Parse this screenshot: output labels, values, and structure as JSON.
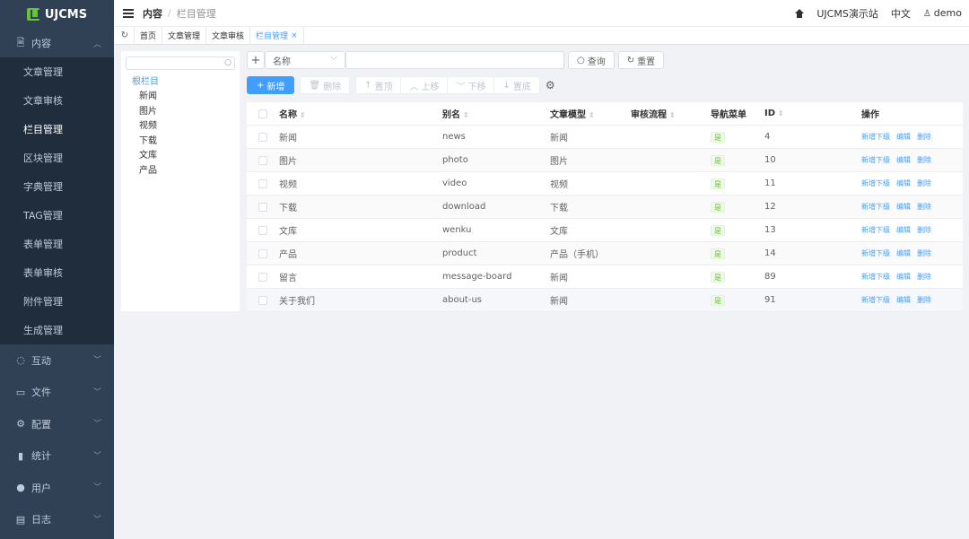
{
  "app": {
    "logo_text": "UJCMS"
  },
  "sidebar": {
    "content_group": "内容",
    "content_items": [
      "文章管理",
      "文章审核",
      "栏目管理",
      "区块管理",
      "字典管理",
      "TAG管理",
      "表单管理",
      "表单审核",
      "附件管理",
      "生成管理"
    ],
    "active_item": "栏目管理",
    "groups": [
      {
        "label": "互动",
        "icon": "chat-icon"
      },
      {
        "label": "文件",
        "icon": "folder-icon"
      },
      {
        "label": "配置",
        "icon": "gear-icon"
      },
      {
        "label": "统计",
        "icon": "bar-chart-icon"
      },
      {
        "label": "用户",
        "icon": "user-icon"
      },
      {
        "label": "日志",
        "icon": "log-icon"
      }
    ]
  },
  "header": {
    "breadcrumb": [
      "内容",
      "栏目管理"
    ],
    "site": "UJCMS演示站",
    "lang": "中文",
    "user": "demo"
  },
  "tabs": {
    "items": [
      "首页",
      "文章管理",
      "文章审核",
      "栏目管理"
    ],
    "active": "栏目管理"
  },
  "tree": {
    "search_value": "",
    "root": "根栏目",
    "children": [
      "新闻",
      "图片",
      "视频",
      "下载",
      "文库",
      "产品"
    ]
  },
  "search": {
    "field": "名称",
    "value": "",
    "query_button": "查询",
    "reset_button": "重置"
  },
  "toolbar": {
    "add": "新增",
    "delete": "删除",
    "top": "置顶",
    "up": "上移",
    "down": "下移",
    "bottom": "置底"
  },
  "table": {
    "columns": [
      "名称",
      "别名",
      "文章模型",
      "审核流程",
      "导航菜单",
      "ID",
      "操作"
    ],
    "rows": [
      {
        "name": "新闻",
        "alias": "news",
        "model": "新闻",
        "process": "",
        "nav": "是",
        "id": "4"
      },
      {
        "name": "图片",
        "alias": "photo",
        "model": "图片",
        "process": "",
        "nav": "是",
        "id": "10"
      },
      {
        "name": "视频",
        "alias": "video",
        "model": "视频",
        "process": "",
        "nav": "是",
        "id": "11"
      },
      {
        "name": "下载",
        "alias": "download",
        "model": "下载",
        "process": "",
        "nav": "是",
        "id": "12"
      },
      {
        "name": "文库",
        "alias": "wenku",
        "model": "文库",
        "process": "",
        "nav": "是",
        "id": "13"
      },
      {
        "name": "产品",
        "alias": "product",
        "model": "产品（手机）",
        "process": "",
        "nav": "是",
        "id": "14"
      },
      {
        "name": "留言",
        "alias": "message-board",
        "model": "新闻",
        "process": "",
        "nav": "是",
        "id": "89"
      },
      {
        "name": "关于我们",
        "alias": "about-us",
        "model": "新闻",
        "process": "",
        "nav": "是",
        "id": "91"
      }
    ],
    "row_actions": [
      "新增下级",
      "编辑",
      "删除"
    ]
  }
}
